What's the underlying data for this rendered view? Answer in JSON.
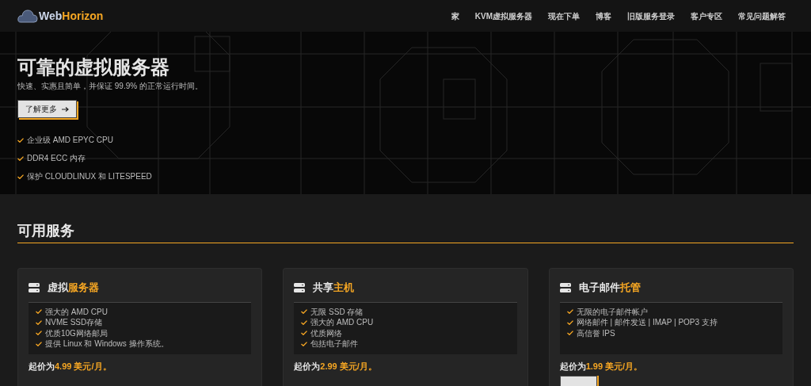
{
  "logo": {
    "part1": "Web",
    "part2": "Horizon"
  },
  "nav": [
    {
      "label": "家"
    },
    {
      "label": "KVM虚拟服务器"
    },
    {
      "label": "现在下单"
    },
    {
      "label": "博客"
    },
    {
      "label": "旧版服务登录"
    },
    {
      "label": "客户专区"
    },
    {
      "label": "常见问题解答"
    }
  ],
  "hero": {
    "title": "可靠的虚拟服务器",
    "subtitle": "快速、实惠且简单，并保证 99.9% 的正常运行时间。",
    "button": "了解更多",
    "features": [
      "企业级 AMD EPYC CPU",
      "DDR4 ECC 内存",
      "保护 CLOUDLINUX 和 LITESPEED"
    ]
  },
  "section": {
    "title": "可用服务"
  },
  "cards": [
    {
      "title": "虚拟",
      "title_highlight": "服务器",
      "features": [
        "强大的 AMD CPU",
        "NVME SSD存储",
        "优质10G网络邮局",
        "提供 Linux 和 Windows 操作系统。"
      ],
      "price_label": "起价为",
      "price_value": "4.99 美元/月。"
    },
    {
      "title": "共享",
      "title_highlight": "主机",
      "features": [
        "无限 SSD 存储",
        "强大的 AMD CPU",
        "优质网络",
        "包括电子邮件"
      ],
      "price_label": "起价为",
      "price_value": "2.99 美元/月。"
    },
    {
      "title": "电子邮件",
      "title_highlight": "托管",
      "features": [
        "无限的电子邮件帐户",
        "网络邮件 | 邮件发送 | IMAP | POP3 支持",
        "高信誉 IPS"
      ],
      "price_label": "起价为",
      "price_value": "1.99 美元/月。",
      "has_button": true
    }
  ]
}
